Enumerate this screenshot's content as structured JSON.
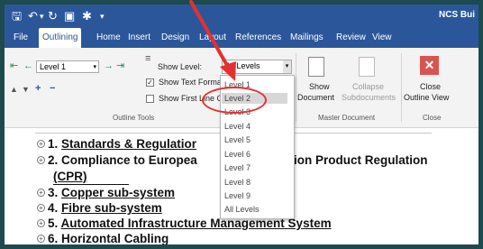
{
  "window": {
    "title": "NCS Bui"
  },
  "quick_access": [
    "save-icon",
    "undo-icon",
    "redo-icon",
    "print-preview-icon",
    "customize-icon"
  ],
  "tabs": [
    {
      "label": "File",
      "active": false
    },
    {
      "label": "Outlining",
      "active": true
    },
    {
      "label": "Home",
      "active": false
    },
    {
      "label": "Insert",
      "active": false
    },
    {
      "label": "Design",
      "active": false
    },
    {
      "label": "Layout",
      "active": false
    },
    {
      "label": "References",
      "active": false
    },
    {
      "label": "Mailings",
      "active": false
    },
    {
      "label": "Review",
      "active": false
    },
    {
      "label": "View",
      "active": false
    }
  ],
  "outline_tools": {
    "level_value": "Level 1",
    "show_level_label": "Show Level:",
    "show_level_value": "All Levels",
    "show_text_formatting": "Show Text Formatting",
    "show_text_formatting_checked": true,
    "show_first_line_only": "Show First Line Only",
    "show_first_line_only_checked": false,
    "group_label": "Outline Tools"
  },
  "master_document": {
    "show_document_line1": "Show",
    "show_document_line2": "Document",
    "collapse_line1": "Collapse",
    "collapse_line2": "Subdocuments",
    "group_label": "Master Document"
  },
  "close_group": {
    "close_line1": "Close",
    "close_line2": "Outline View",
    "group_label": "Close"
  },
  "dropdown": {
    "items": [
      "Level 1",
      "Level 2",
      "Level 3",
      "Level 4",
      "Level 5",
      "Level 6",
      "Level 7",
      "Level 8",
      "Level 9",
      "All Levels"
    ],
    "highlighted": "Level 2"
  },
  "document_lines": [
    {
      "number": "1.",
      "text": "Standards & Regulatior",
      "underline": true
    },
    {
      "number": "2.",
      "text": "Compliance to Europea",
      "continued": "ction Product Regulation",
      "underline": false
    },
    {
      "number": "",
      "text": "(CPR)",
      "underline": true
    },
    {
      "number": "3.",
      "text": "Copper sub-system",
      "underline": true
    },
    {
      "number": "4.",
      "text": "Fibre sub-system",
      "underline": true
    },
    {
      "number": "5.",
      "text": "Automated Infrastructure Management System",
      "underline": true
    },
    {
      "number": "6.",
      "text": "Horizontal Cabling",
      "underline": false
    }
  ],
  "annotation": {
    "color": "#e53030",
    "target": "Level 2"
  },
  "colors": {
    "ribbon_blue": "#2b579a",
    "border_teal": "#1d4a4e",
    "close_red": "#d9534f"
  }
}
